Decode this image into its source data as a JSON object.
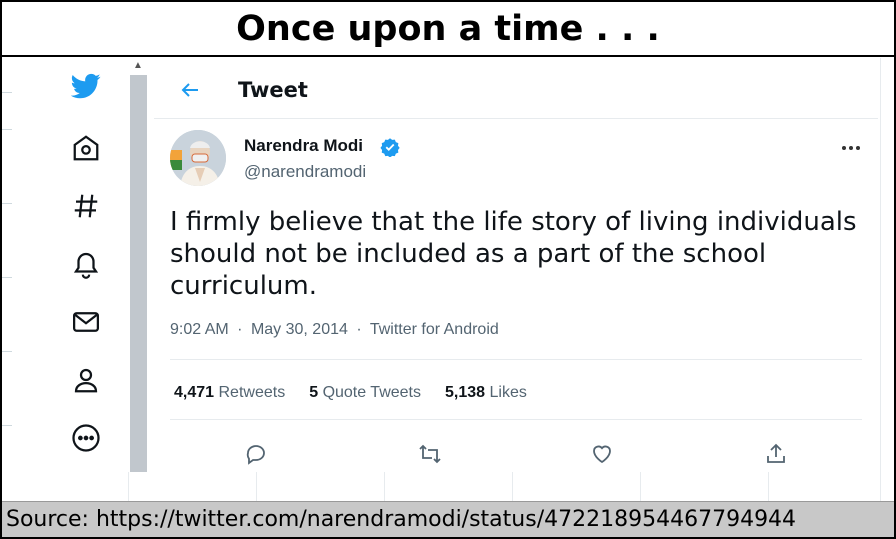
{
  "banner": {
    "title": "Once upon a time . . ."
  },
  "header": {
    "title": "Tweet"
  },
  "nav": {
    "icons": [
      "twitter-bird-icon",
      "home-icon",
      "explore-hashtag-icon",
      "notifications-bell-icon",
      "messages-envelope-icon",
      "profile-icon",
      "more-circle-icon"
    ]
  },
  "tweet": {
    "author_name": "Narendra Modi",
    "author_handle": "@narendramodi",
    "text_line1": "I firmly believe that the life story of living individuals",
    "text_line2": "should not be included as a part of the school",
    "text_line3": "curriculum.",
    "time": "9:02 AM",
    "date": "May 30, 2014",
    "client": "Twitter for Android",
    "separator": "·",
    "retweets_count": "4,471",
    "retweets_label": "Retweets",
    "quotes_count": "5",
    "quotes_label": "Quote Tweets",
    "likes_count": "5,138",
    "likes_label": "Likes"
  },
  "source": {
    "text": "Source: https://twitter.com/narendramodi/status/472218954467794944"
  },
  "colors": {
    "twitter_blue": "#1d9bf0",
    "text_primary": "#0f1419",
    "text_secondary": "#536471"
  }
}
